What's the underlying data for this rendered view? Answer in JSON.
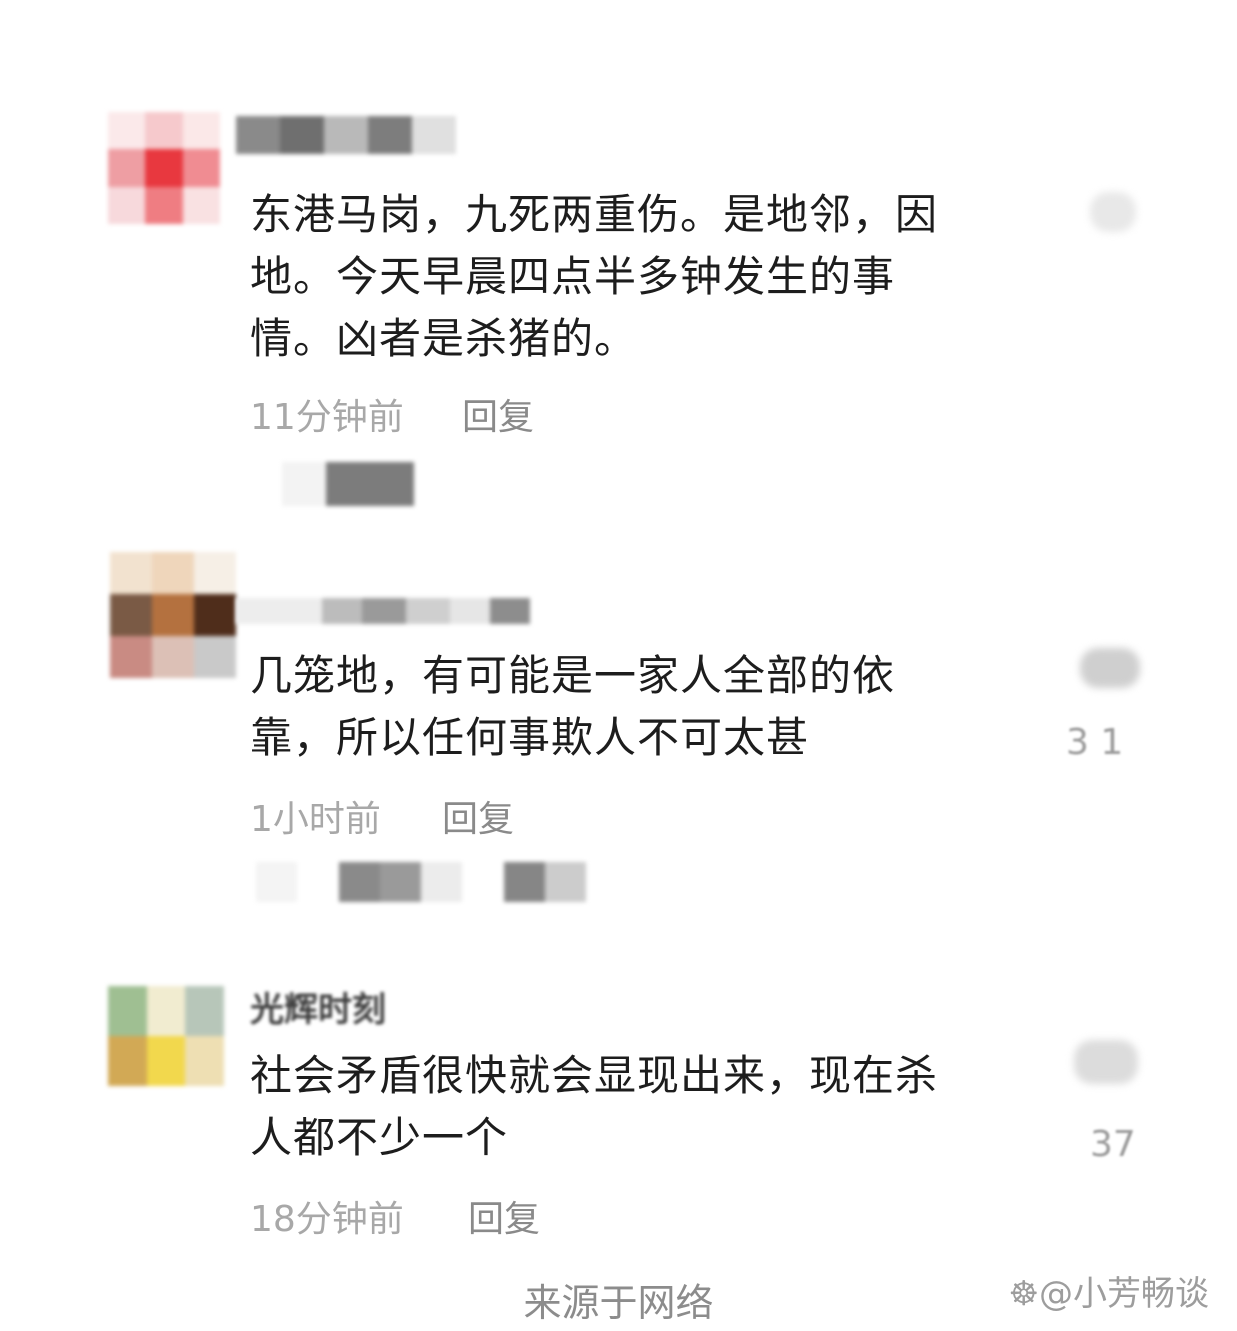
{
  "comments": [
    {
      "username": "",
      "text_lines": [
        "东港马岗，九死两重伤。是地邻，因",
        "地。今天早晨四点半多钟发生的事",
        "情。凶者是杀猪的。"
      ],
      "time": "11分钟前",
      "reply_label": "回复",
      "like_count": ""
    },
    {
      "username": "",
      "text_lines": [
        "几笼地，有可能是一家人全部的依",
        "靠，所以任何事欺人不可太甚"
      ],
      "time": "1小时前",
      "reply_label": "回复",
      "like_count": "3 1"
    },
    {
      "username": "光辉时刻",
      "text_lines": [
        "社会矛盾很快就会显现出来，现在杀",
        "人都不少一个"
      ],
      "time": "18分钟前",
      "reply_label": "回复",
      "like_count": "37"
    }
  ],
  "footer": {
    "source": "来源于网络",
    "watermark": "@小芳畅谈"
  }
}
